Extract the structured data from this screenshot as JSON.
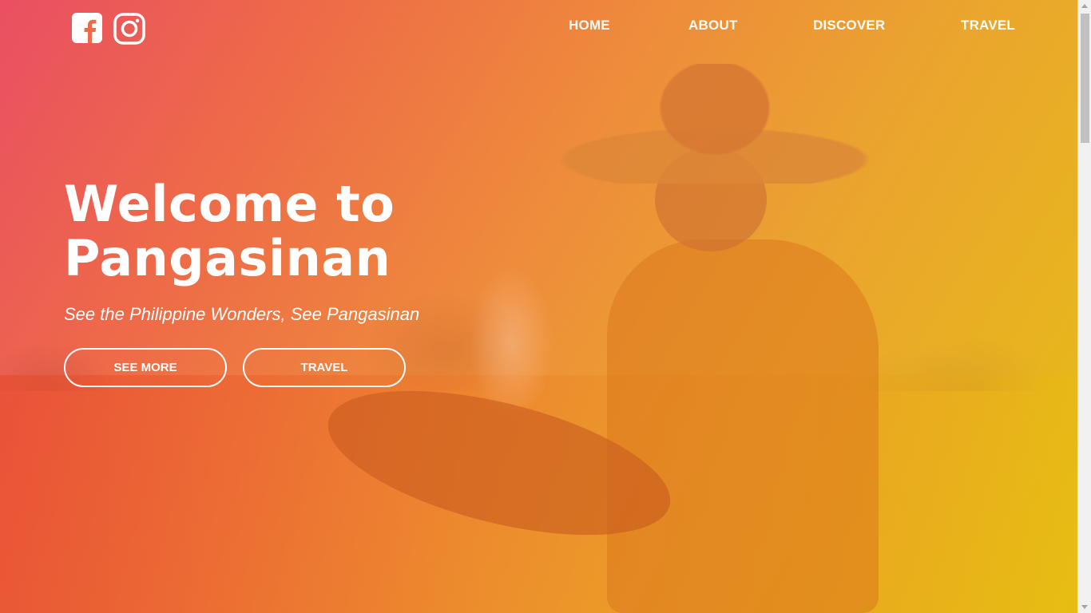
{
  "social": {
    "facebook_icon": "facebook-icon",
    "instagram_icon": "instagram-icon"
  },
  "nav": {
    "items": [
      {
        "label": "HOME"
      },
      {
        "label": "ABOUT"
      },
      {
        "label": "DISCOVER"
      },
      {
        "label": "TRAVEL"
      }
    ]
  },
  "hero": {
    "title_line1": "Welcome to",
    "title_line2": "Pangasinan",
    "subtitle": "See the Philippine Wonders, See Pangasinan",
    "buttons": {
      "see_more": "SEE MORE",
      "travel": "TRAVEL"
    },
    "background_image": "woman-winnowing-rice-in-field",
    "overlay_colors": [
      "#ea4f63",
      "#ee8a3c",
      "#e6bd15"
    ]
  },
  "colors": {
    "text": "#ffffff",
    "accent": "#ee8a3c"
  }
}
